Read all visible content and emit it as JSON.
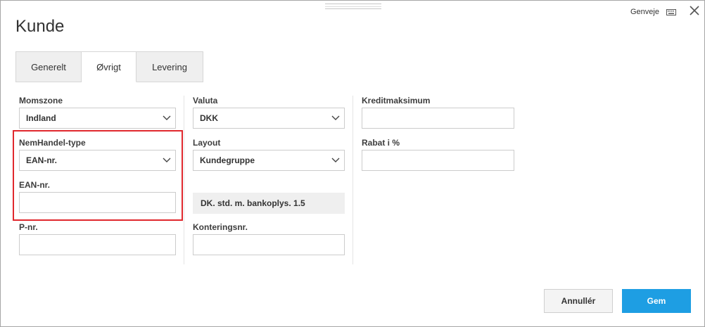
{
  "dialog": {
    "title": "Kunde",
    "shortcut_label": "Genveje"
  },
  "tabs": [
    {
      "label": "Generelt",
      "active": false
    },
    {
      "label": "Øvrigt",
      "active": true
    },
    {
      "label": "Levering",
      "active": false
    }
  ],
  "form": {
    "momszone": {
      "label": "Momszone",
      "value": "Indland"
    },
    "nemhandel_type": {
      "label": "NemHandel-type",
      "value": "EAN-nr."
    },
    "ean_nr": {
      "label": "EAN-nr.",
      "value": ""
    },
    "p_nr": {
      "label": "P-nr.",
      "value": ""
    },
    "valuta": {
      "label": "Valuta",
      "value": "DKK"
    },
    "layout": {
      "label": "Layout",
      "value": "Kundegruppe",
      "info": "DK. std. m. bankoplys. 1.5"
    },
    "konteringsnr": {
      "label": "Konteringsnr.",
      "value": ""
    },
    "kreditmaksimum": {
      "label": "Kreditmaksimum",
      "value": ""
    },
    "rabat": {
      "label": "Rabat i %",
      "value": ""
    }
  },
  "buttons": {
    "cancel": "Annullér",
    "save": "Gem"
  },
  "colors": {
    "primary": "#1e9ee3",
    "highlight": "#e0282d"
  }
}
